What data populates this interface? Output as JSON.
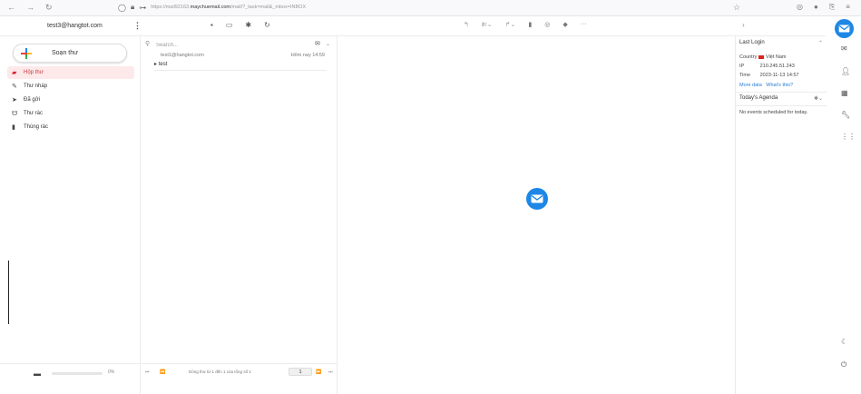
{
  "browser": {
    "url_prefix": "https://mail92163.",
    "url_domain": "maychuemail.com",
    "url_suffix": "/mail/?_task=mail&_mbox=INBOX"
  },
  "header": {
    "account": "test3@hangtot.com"
  },
  "sidebar": {
    "compose_label": "Soạn thư",
    "folders": [
      {
        "label": "Hộp thư",
        "icon": "inbox-icon",
        "active": true
      },
      {
        "label": "Thư nháp",
        "icon": "pencil-icon",
        "active": false
      },
      {
        "label": "Đã gửi",
        "icon": "send-icon",
        "active": false
      },
      {
        "label": "Thư rác",
        "icon": "spam-icon",
        "active": false
      },
      {
        "label": "Thùng rác",
        "icon": "trash-icon",
        "active": false
      }
    ],
    "quota_percent": "0%",
    "quota_fraction": 0
  },
  "message_list": {
    "search_placeholder": "Search...",
    "messages": [
      {
        "from": "test1@hangtot.com",
        "date": "Hôm nay 14:59",
        "subject": "test"
      }
    ],
    "pagination_text": "Dòng thư từ 1 đến 1 của tổng số 1",
    "page": "1"
  },
  "info_panel": {
    "last_login_title": "Last Login",
    "country_label": "Country",
    "country_value": "Việt Nam",
    "ip_label": "IP",
    "ip_value": "210.245.51.243",
    "time_label": "Time",
    "time_value": "2023-11-13 14:57",
    "more_data": "More data",
    "whats_this": "What's this?",
    "agenda_title": "Today's Agenda",
    "agenda_empty": "No events scheduled for today."
  },
  "colors": {
    "accent": "#1e87e6",
    "active_folder_bg": "#fde8ea",
    "active_folder_text": "#c43a3a"
  }
}
